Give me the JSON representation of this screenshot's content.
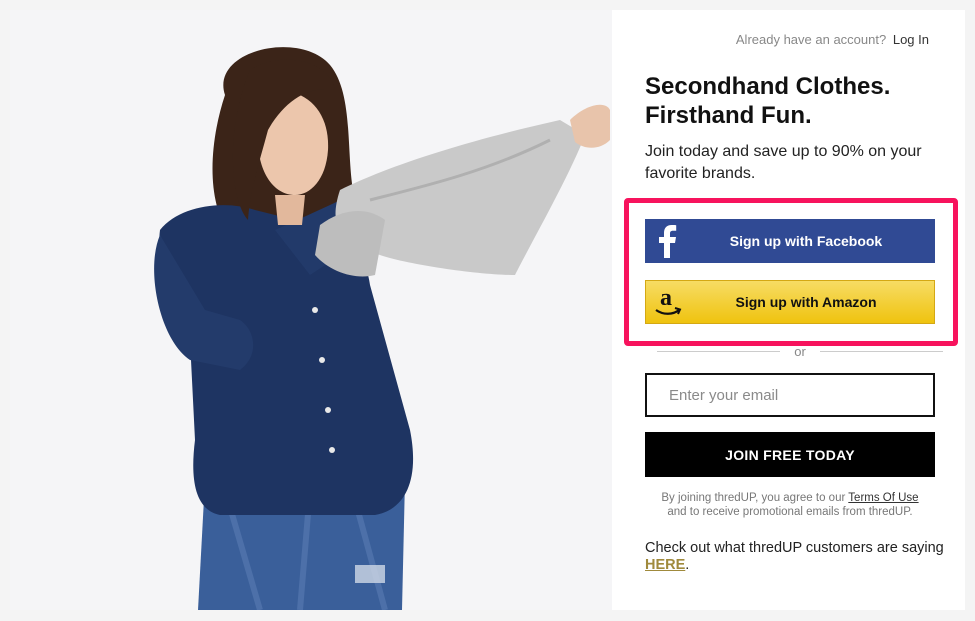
{
  "header": {
    "account_prompt": "Already have an account?",
    "login_link": "Log In"
  },
  "hero": {
    "headline_line1": "Secondhand Clothes.",
    "headline_line2": "Firsthand Fun.",
    "subline": "Join today and save up to 90% on your favorite brands."
  },
  "social": {
    "facebook_label": "Sign up with Facebook",
    "facebook_icon": "facebook-f-icon",
    "amazon_label": "Sign up with Amazon",
    "amazon_icon": "amazon-a-icon",
    "highlight_color": "#f7135d"
  },
  "divider": {
    "or_text": "or"
  },
  "form": {
    "email_placeholder": "Enter your email",
    "submit_label": "JOIN FREE TODAY"
  },
  "terms": {
    "prefix": "By joining thredUP, you agree to our",
    "terms_link": "Terms Of Use",
    "suffix": "and to receive promotional emails from thredUP."
  },
  "testimonial": {
    "text": "Check out what thredUP customers are saying",
    "link": "HERE",
    "end": "."
  },
  "colors": {
    "facebook_blue": "#304a94",
    "amazon_yellow": "#f2cb2a",
    "link_gold": "#a08a3c"
  }
}
